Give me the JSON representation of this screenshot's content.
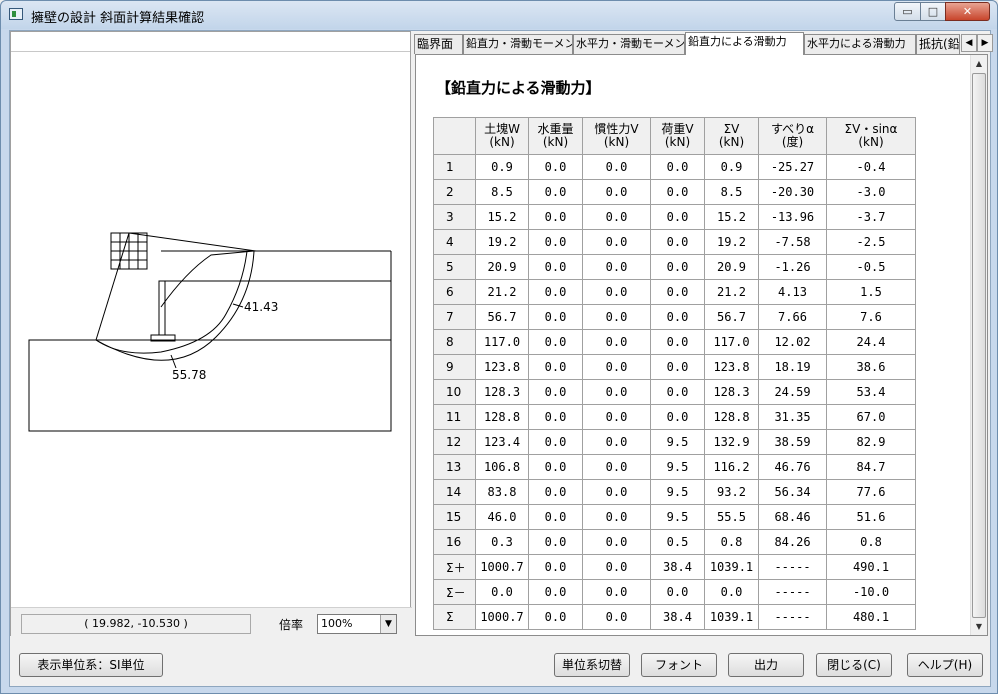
{
  "window": {
    "title": "擁壁の設計 斜面計算結果確認",
    "min_glyph": "▭",
    "max_glyph": "□",
    "close_glyph": "✕"
  },
  "left": {
    "coords": "(  19.982, -10.530 )",
    "zoom_label": "倍率",
    "zoom_value": "100%",
    "drawing_labels": {
      "arc1": "41.43",
      "arc2": "55.78"
    }
  },
  "tabs": [
    {
      "label": "臨界面",
      "active": false
    },
    {
      "label": "鉛直力・滑動モーメント",
      "active": false
    },
    {
      "label": "水平力・滑動モーメント",
      "active": false
    },
    {
      "label": "鉛直力による滑動力",
      "active": true
    },
    {
      "label": "水平力による滑動力",
      "active": false
    },
    {
      "label": "抵抗(鉛",
      "active": false
    }
  ],
  "sheet": {
    "title": "【鉛直力による滑動力】",
    "headers": [
      {
        "name": "土塊W",
        "unit": "(kN)"
      },
      {
        "name": "水重量",
        "unit": "(kN)"
      },
      {
        "name": "慣性力V",
        "unit": "(kN)"
      },
      {
        "name": "荷重V",
        "unit": "(kN)"
      },
      {
        "name": "ΣV",
        "unit": "(kN)"
      },
      {
        "name": "すべりα",
        "unit": "(度)"
      },
      {
        "name": "ΣV・sinα",
        "unit": "(kN)"
      }
    ],
    "rows": [
      {
        "label": "1",
        "cells": [
          "0.9",
          "0.0",
          "0.0",
          "0.0",
          "0.9",
          "-25.27",
          "-0.4"
        ]
      },
      {
        "label": "2",
        "cells": [
          "8.5",
          "0.0",
          "0.0",
          "0.0",
          "8.5",
          "-20.30",
          "-3.0"
        ]
      },
      {
        "label": "3",
        "cells": [
          "15.2",
          "0.0",
          "0.0",
          "0.0",
          "15.2",
          "-13.96",
          "-3.7"
        ]
      },
      {
        "label": "4",
        "cells": [
          "19.2",
          "0.0",
          "0.0",
          "0.0",
          "19.2",
          "-7.58",
          "-2.5"
        ]
      },
      {
        "label": "5",
        "cells": [
          "20.9",
          "0.0",
          "0.0",
          "0.0",
          "20.9",
          "-1.26",
          "-0.5"
        ]
      },
      {
        "label": "6",
        "cells": [
          "21.2",
          "0.0",
          "0.0",
          "0.0",
          "21.2",
          "4.13",
          "1.5"
        ]
      },
      {
        "label": "7",
        "cells": [
          "56.7",
          "0.0",
          "0.0",
          "0.0",
          "56.7",
          "7.66",
          "7.6"
        ]
      },
      {
        "label": "8",
        "cells": [
          "117.0",
          "0.0",
          "0.0",
          "0.0",
          "117.0",
          "12.02",
          "24.4"
        ]
      },
      {
        "label": "9",
        "cells": [
          "123.8",
          "0.0",
          "0.0",
          "0.0",
          "123.8",
          "18.19",
          "38.6"
        ]
      },
      {
        "label": "10",
        "cells": [
          "128.3",
          "0.0",
          "0.0",
          "0.0",
          "128.3",
          "24.59",
          "53.4"
        ]
      },
      {
        "label": "11",
        "cells": [
          "128.8",
          "0.0",
          "0.0",
          "0.0",
          "128.8",
          "31.35",
          "67.0"
        ]
      },
      {
        "label": "12",
        "cells": [
          "123.4",
          "0.0",
          "0.0",
          "9.5",
          "132.9",
          "38.59",
          "82.9"
        ]
      },
      {
        "label": "13",
        "cells": [
          "106.8",
          "0.0",
          "0.0",
          "9.5",
          "116.2",
          "46.76",
          "84.7"
        ]
      },
      {
        "label": "14",
        "cells": [
          "83.8",
          "0.0",
          "0.0",
          "9.5",
          "93.2",
          "56.34",
          "77.6"
        ]
      },
      {
        "label": "15",
        "cells": [
          "46.0",
          "0.0",
          "0.0",
          "9.5",
          "55.5",
          "68.46",
          "51.6"
        ]
      },
      {
        "label": "16",
        "cells": [
          "0.3",
          "0.0",
          "0.0",
          "0.5",
          "0.8",
          "84.26",
          "0.8"
        ]
      },
      {
        "label": "Σ＋",
        "cells": [
          "1000.7",
          "0.0",
          "0.0",
          "38.4",
          "1039.1",
          "-----",
          "490.1"
        ]
      },
      {
        "label": "Σ－",
        "cells": [
          "0.0",
          "0.0",
          "0.0",
          "0.0",
          "0.0",
          "-----",
          "-10.0"
        ]
      },
      {
        "label": "Σ",
        "cells": [
          "1000.7",
          "0.0",
          "0.0",
          "38.4",
          "1039.1",
          "-----",
          "480.1"
        ]
      }
    ]
  },
  "footer": {
    "unit_system": "表示単位系：SI単位",
    "switch_units": "単位系切替",
    "font": "フォント",
    "output": "出力",
    "close": "閉じる(C)",
    "help": "ヘルプ(H)"
  }
}
